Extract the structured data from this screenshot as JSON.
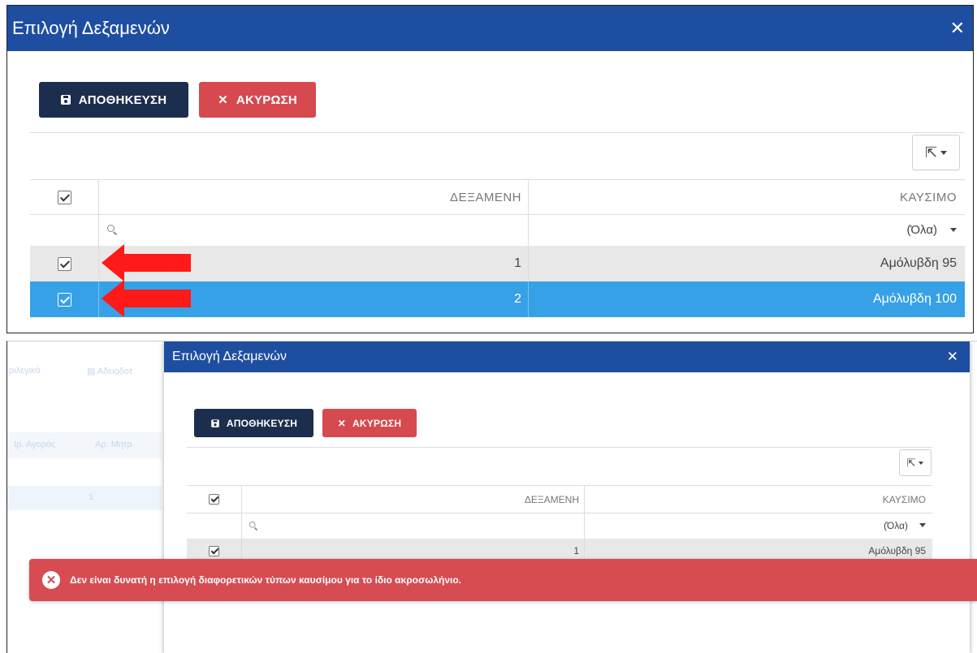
{
  "top": {
    "title": "Επιλογή Δεξαμενών",
    "close_glyph": "✕",
    "save_label": "ΑΠΟΘΗΚΕΥΣΗ",
    "cancel_label": "ΑΚΥΡΩΣΗ",
    "cancel_glyph": "✕",
    "export_glyph": "⇱",
    "columns": [
      "ΔΕΞΑΜΕΝΗ",
      "ΚΑΥΣΙΜΟ"
    ],
    "fuel_filter": "(Όλα)",
    "rows": [
      {
        "tank": "1",
        "fuel": "Αμόλυβδη 95",
        "checked": true,
        "selected": false
      },
      {
        "tank": "2",
        "fuel": "Αμόλυβδη 100",
        "checked": true,
        "selected": true
      }
    ],
    "arrow_color": "#ff1a1a"
  },
  "bottom": {
    "background_toolbar": [
      "ριλεγικά",
      "Αδειοδοτ"
    ],
    "background_columns": [
      "Ιρ. Αγοράς",
      "Αρ. Μητρ"
    ],
    "background_row_value": "1",
    "modal": {
      "title": "Επιλογή Δεξαμενών",
      "close_glyph": "✕",
      "save_label": "ΑΠΟΘΗΚΕΥΣΗ",
      "cancel_label": "ΑΚΥΡΩΣΗ",
      "cancel_glyph": "✕",
      "export_glyph": "⇱",
      "columns": [
        "ΔΕΞΑΜΕΝΗ",
        "ΚΑΥΣΙΜΟ"
      ],
      "fuel_filter": "(Όλα)",
      "rows": [
        {
          "tank": "1",
          "fuel": "Αμόλυβδη 95",
          "checked": true
        }
      ]
    },
    "error_message": "Δεν είναι δυνατή η επιλογή διαφορετικών τύπων καυσίμου για το ίδιο ακροσωλήνιο.",
    "error_glyph": "✕"
  },
  "colors": {
    "titlebar": "#1e4ea0",
    "save_button": "#1c2e4d",
    "cancel_button": "#d6494e",
    "selected_row": "#36a1e6",
    "error_bar": "#d64c52"
  }
}
